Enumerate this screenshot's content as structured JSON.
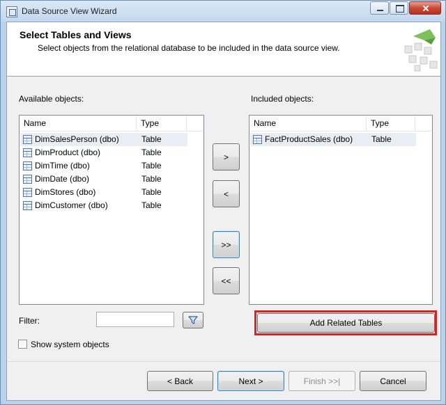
{
  "window": {
    "title": "Data Source View Wizard"
  },
  "header": {
    "title": "Select Tables and Views",
    "subtitle": "Select objects from the relational database to be included in the data source view."
  },
  "available": {
    "label": "Available objects:",
    "columns": {
      "name": "Name",
      "type": "Type"
    },
    "rows": [
      {
        "name": "DimSalesPerson (dbo)",
        "type": "Table",
        "selected": true
      },
      {
        "name": "DimProduct (dbo)",
        "type": "Table"
      },
      {
        "name": "DimTime (dbo)",
        "type": "Table"
      },
      {
        "name": "DimDate (dbo)",
        "type": "Table"
      },
      {
        "name": "DimStores (dbo)",
        "type": "Table"
      },
      {
        "name": "DimCustomer (dbo)",
        "type": "Table"
      }
    ]
  },
  "included": {
    "label": "Included objects:",
    "columns": {
      "name": "Name",
      "type": "Type"
    },
    "rows": [
      {
        "name": "FactProductSales (dbo)",
        "type": "Table",
        "selected": true
      }
    ]
  },
  "transfer": {
    "add": ">",
    "remove": "<",
    "add_all": ">>",
    "remove_all": "<<"
  },
  "filter": {
    "label": "Filter:",
    "value": "",
    "icon": "funnel-icon"
  },
  "show_system_objects": {
    "label": "Show system objects",
    "checked": false
  },
  "add_related": "Add Related Tables",
  "footer": {
    "back": "< Back",
    "next": "Next >",
    "finish": "Finish >>|",
    "cancel": "Cancel"
  },
  "colors": {
    "highlight": "#d42424",
    "titlebar": "#c3d8ee",
    "selected_row": "#e9eef5",
    "default_button_border": "#3c7fb1"
  }
}
